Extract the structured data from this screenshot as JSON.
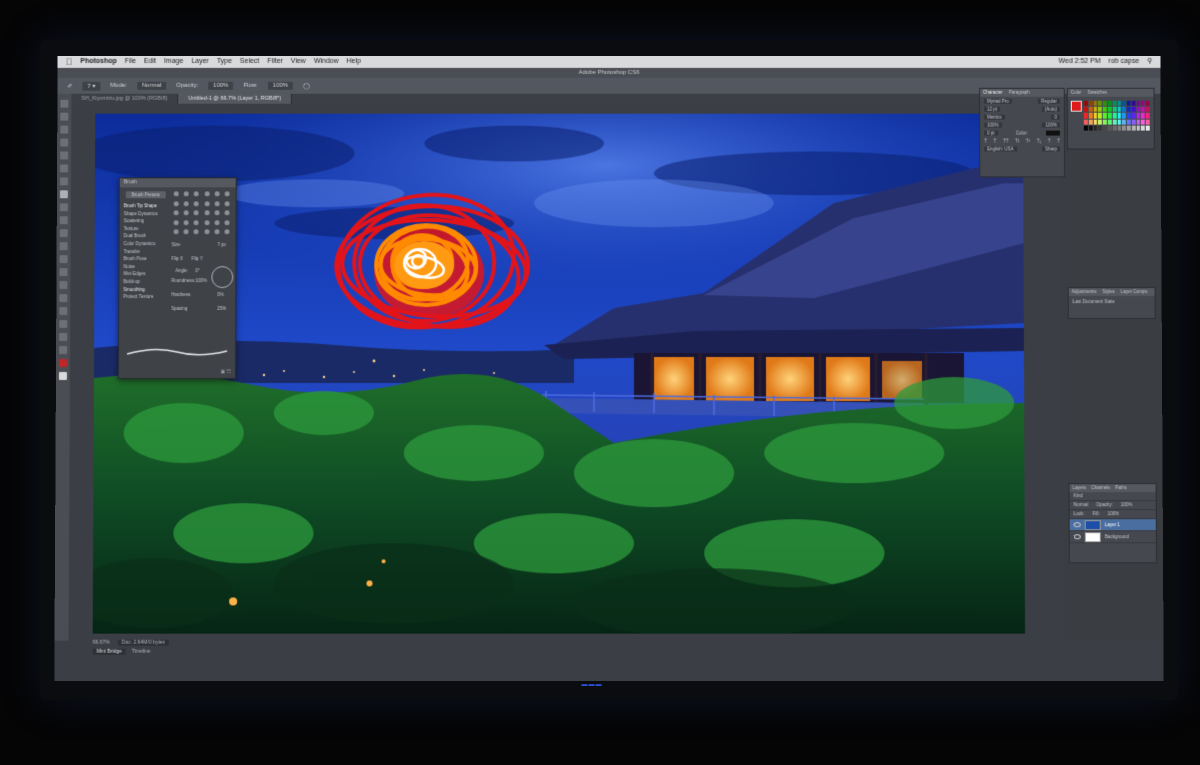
{
  "menubar": {
    "apple": "",
    "app_name": "Photoshop",
    "items": [
      "File",
      "Edit",
      "Image",
      "Layer",
      "Type",
      "Select",
      "Filter",
      "View",
      "Window",
      "Help"
    ],
    "status_items": [
      "Wed 2:52 PM",
      "rob capse"
    ]
  },
  "window_title": "Adobe Photoshop CS6",
  "options_bar": {
    "mode_label": "Mode:",
    "mode_value": "Normal",
    "opacity_label": "Opacity:",
    "opacity_value": "100%",
    "flow_label": "Flow:",
    "flow_value": "100%"
  },
  "document_tabs": [
    {
      "label": "SH_Kiyomizu.jpg @ 100% (RGB/8)",
      "active": false
    },
    {
      "label": "Untitled-1 @ 66.7% (Layer 1, RGB/8*)",
      "active": true
    }
  ],
  "brush_panel": {
    "title": "Brush",
    "presets_button": "Brush Presets",
    "options": [
      {
        "label": "Brush Tip Shape",
        "on": true
      },
      {
        "label": "Shape Dynamics",
        "on": false
      },
      {
        "label": "Scattering",
        "on": false
      },
      {
        "label": "Texture",
        "on": false
      },
      {
        "label": "Dual Brush",
        "on": false
      },
      {
        "label": "Color Dynamics",
        "on": false
      },
      {
        "label": "Transfer",
        "on": false
      },
      {
        "label": "Brush Pose",
        "on": false
      },
      {
        "label": "Noise",
        "on": false
      },
      {
        "label": "Wet Edges",
        "on": false
      },
      {
        "label": "Build-up",
        "on": false
      },
      {
        "label": "Smoothing",
        "on": true
      },
      {
        "label": "Protect Texture",
        "on": false
      }
    ],
    "size_label": "Size",
    "size_value": "7 px",
    "flip_x": "Flip X",
    "flip_y": "Flip Y",
    "angle_label": "Angle:",
    "angle_value": "0°",
    "roundness_label": "Roundness:",
    "roundness_value": "100%",
    "hardness_label": "Hardness",
    "hardness_value": "0%",
    "spacing_label": "Spacing",
    "spacing_value": "25%"
  },
  "character_panel": {
    "tabs": [
      "Character",
      "Paragraph"
    ],
    "font_family": "Myriad Pro",
    "font_style": "Regular",
    "font_size": "12 pt",
    "leading": "(Auto)",
    "kerning": "Metrics",
    "tracking": "0",
    "vertical_scale": "100%",
    "horizontal_scale": "100%",
    "baseline": "0 pt",
    "color_label": "Color:",
    "language": "English: USA",
    "anti_alias": "Sharp"
  },
  "color_panel": {
    "tabs": [
      "Color",
      "Swatches"
    ],
    "foreground_color": "#e01b1b"
  },
  "adjustments_panel": {
    "tabs": [
      "Adjustments",
      "Styles",
      "Layer Comps"
    ],
    "item": "Last Document State"
  },
  "layers_panel": {
    "tabs": [
      "Layers",
      "Channels",
      "Paths"
    ],
    "kind_label": "Kind",
    "blend_mode": "Normal",
    "opacity_label": "Opacity:",
    "opacity_value": "100%",
    "lock_label": "Lock:",
    "fill_label": "Fill:",
    "fill_value": "100%",
    "layers": [
      {
        "name": "Layer 1",
        "selected": true,
        "thumb": "blue"
      },
      {
        "name": "Background",
        "selected": false,
        "thumb": "white"
      }
    ]
  },
  "status_bar": {
    "zoom": "66.67%",
    "doc_info": "Doc: 2.64M/0 bytes"
  },
  "bottom_tabs": [
    "Mini Bridge",
    "Timeline"
  ],
  "colors": {
    "scribble_red": "#e2141a",
    "scribble_orange": "#ff8a00",
    "scribble_white": "#ffffff",
    "sky_blue": "#1f49c9",
    "foliage_green": "#1d7a2c",
    "ui_dark": "#3b3e44"
  }
}
